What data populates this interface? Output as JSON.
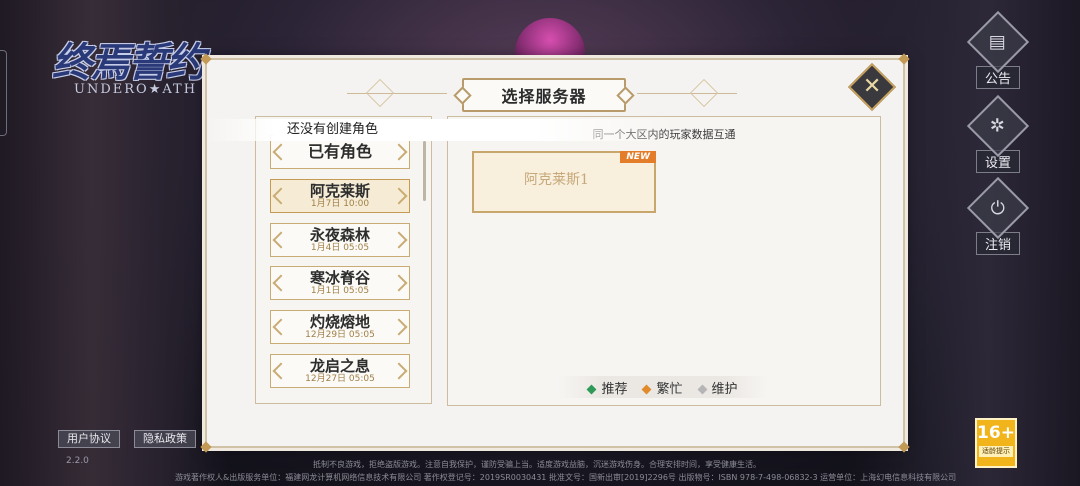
{
  "logo": {
    "cn": "终焉誓约",
    "en": "UNDERO★ATH"
  },
  "side_buttons": [
    {
      "icon": "notice-icon",
      "label": "公告"
    },
    {
      "icon": "settings-icon",
      "label": "设置"
    },
    {
      "icon": "power-icon",
      "label": "注销"
    }
  ],
  "dialog": {
    "title": "选择服务器",
    "close_symbol": "✕",
    "servers": [
      {
        "name": "已有角色",
        "time": ""
      },
      {
        "name": "阿克莱斯",
        "time": "1月7日 10:00"
      },
      {
        "name": "永夜森林",
        "time": "1月4日 05:05"
      },
      {
        "name": "寒冰脊谷",
        "time": "1月1日 05:05"
      },
      {
        "name": "灼烧熔地",
        "time": "12月29日 05:05"
      },
      {
        "name": "龙启之息",
        "time": "12月27日 05:05"
      }
    ],
    "caption": "同一个大区内的玩家数据互通",
    "server_card": {
      "name": "阿克莱斯1",
      "badge": "NEW"
    },
    "toast": "还没有创建角色",
    "legend": [
      {
        "label": "推荐",
        "color": "#2f9a58"
      },
      {
        "label": "繁忙",
        "color": "#e08a2c"
      },
      {
        "label": "维护",
        "color": "#b5b5b5"
      }
    ]
  },
  "bottom": {
    "user_agreement": "用户协议",
    "privacy_policy": "隐私政策",
    "small_info": "2.2.0",
    "notice1": "抵制不良游戏，拒绝盗版游戏。注意自我保护，谨防受骗上当。适度游戏益脑，沉迷游戏伤身。合理安排时间，享受健康生活。",
    "notice2": "游戏著作权人&出版服务单位：福建网龙计算机网络信息技术有限公司   著作权登记号：2019SR0030431   批准文号：国新出审[2019]2296号   出版物号：ISBN 978-7-498-06832-3   运营单位：上海幻电信息科技有限公司",
    "age_rating": "16+",
    "age_note": "适龄提示"
  }
}
